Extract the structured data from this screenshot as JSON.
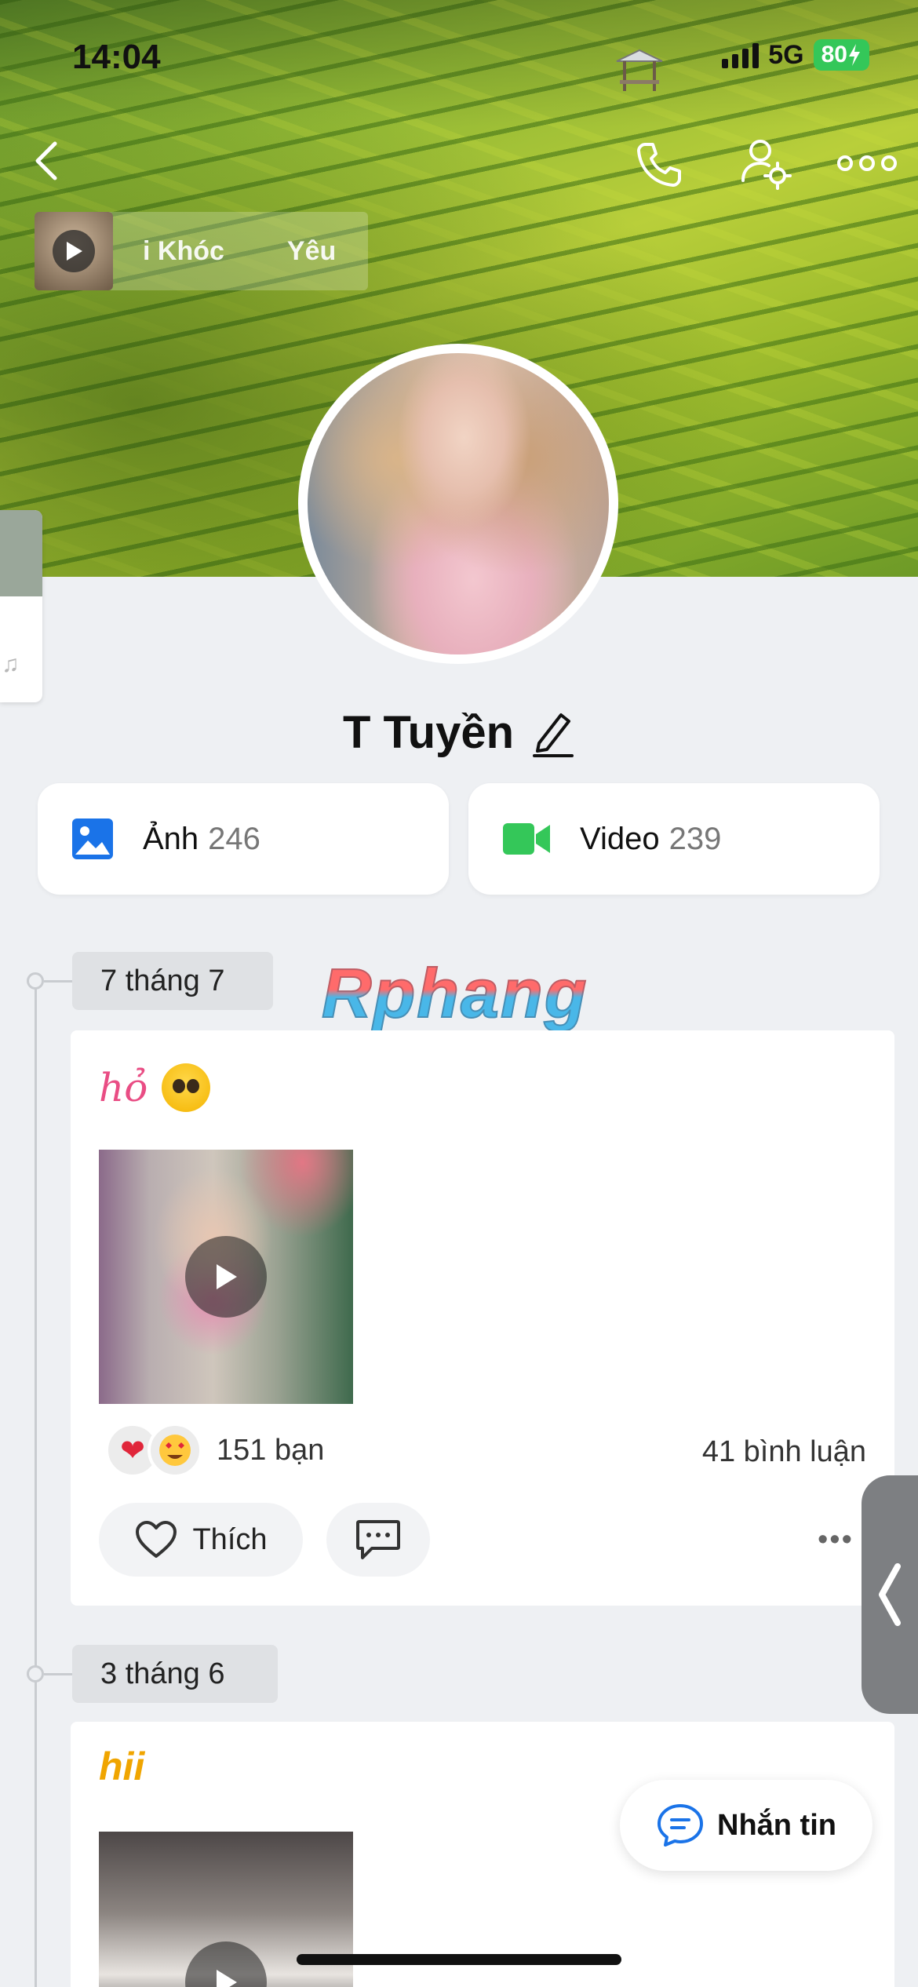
{
  "status_bar": {
    "time": "14:04",
    "network": "5G",
    "battery": "80"
  },
  "music": {
    "song_partial_1": "i Khóc",
    "song_partial_2": "Yêu"
  },
  "profile": {
    "name": "T Tuyền"
  },
  "media": {
    "photo_label": "Ảnh",
    "photo_count": "246",
    "video_label": "Video",
    "video_count": "239"
  },
  "watermark": "Rphang",
  "posts": [
    {
      "date": "7 tháng 7",
      "caption": "hỏ",
      "reaction_count": "151 bạn",
      "comment_count": "41 bình luận",
      "like_label": "Thích"
    },
    {
      "date": "3 tháng 6",
      "caption": "hii"
    }
  ],
  "message_button": "Nhắn tin",
  "colors": {
    "photo_icon": "#1a73e8",
    "video_icon": "#34c759",
    "battery": "#34c759",
    "caption_pink": "#e94d84",
    "caption_gold": "#f0a500",
    "message_icon": "#1a73e8"
  },
  "icons": [
    "back-icon",
    "phone-icon",
    "friend-settings-icon",
    "more-icon",
    "play-icon",
    "pencil-icon",
    "image-icon",
    "video-camera-icon",
    "heart-icon",
    "comment-icon",
    "chat-icon",
    "chevron-left-icon"
  ]
}
